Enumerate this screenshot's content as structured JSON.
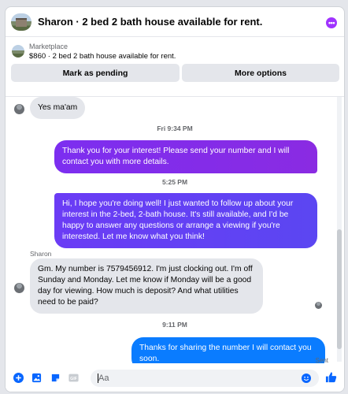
{
  "header": {
    "title": "Sharon · 2 bed 2 bath house available for rent.",
    "menu_glyph": "•••"
  },
  "marketplace": {
    "label": "Marketplace",
    "description": "$860 · 2 bed 2 bath house available for rent.",
    "mark_pending": "Mark as pending",
    "more_options": "More options"
  },
  "messages": {
    "m1": "Yes ma'am",
    "t1": "Fri 9:34 PM",
    "m2": "Thank you for your interest! Please send your number and I will contact you with more details.",
    "t2": "5:25 PM",
    "m3": "Hi, I hope you're doing well! I just wanted to follow up about your interest in the 2-bed, 2-bath house. It's still available, and I'd be happy to answer any questions or arrange a viewing if you're interested. Let me know what you think!",
    "sender": "Sharon",
    "m4": "Gm. My number is 7579456912. I'm just clocking out. I'm off Sunday and Monday. Let me know if Monday will be a good day for viewing. How much is deposit? And what utilities need to be paid?",
    "t3": "9:11 PM",
    "m5": "Thanks for sharing the number I will contact you soon.",
    "status": "Sent"
  },
  "composer": {
    "placeholder": "Aa"
  },
  "colors": {
    "accent": "#0866ff",
    "gradient_purple": "#8a2be2",
    "gradient_violet": "#6b3cf5",
    "gradient_blue": "#0a7cff",
    "menu_purple": "#a033ff"
  },
  "icons": [
    "plus-circle-icon",
    "photo-icon",
    "sticker-icon",
    "gif-icon",
    "emoji-icon",
    "thumbs-up-icon",
    "menu-dots-icon"
  ]
}
